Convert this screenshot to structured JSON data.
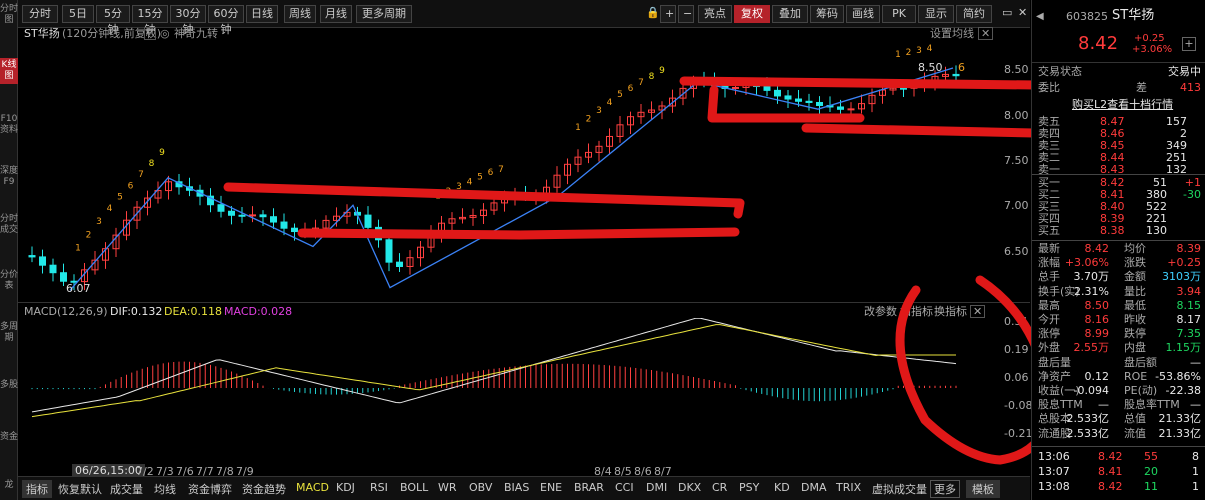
{
  "side_tabs": [
    "分时图",
    "K线图",
    "F10资料",
    "深度F9",
    "分时成交",
    "分价表",
    "多周期",
    "多股",
    "资金",
    "龙"
  ],
  "toolbar": {
    "left": [
      "分时",
      "5日",
      "5分钟",
      "15分钟",
      "30分钟",
      "60分钟",
      "日线",
      "周线",
      "月线",
      "更多周期"
    ],
    "right": [
      "亮点",
      "复权",
      "叠加",
      "筹码",
      "画线",
      "PK",
      "显示",
      "简约"
    ],
    "lock_icon": "lock-icon",
    "minus": "−",
    "plus": "+"
  },
  "chart_info": {
    "title": "ST华扬",
    "subtitle": "(120分钟线,前复权)",
    "help": "?",
    "extra": "神奇九转",
    "settings": "设置均线"
  },
  "price_axis": {
    "ticks": [
      "8.50",
      "8.00",
      "7.50",
      "7.00",
      "6.50"
    ]
  },
  "annotations": {
    "high_label": "8.50",
    "low_label": "6.07",
    "six": "6"
  },
  "nine_turn": [
    {
      "n": "1"
    },
    {
      "n": "2"
    },
    {
      "n": "3"
    },
    {
      "n": "4"
    },
    {
      "n": "5"
    },
    {
      "n": "6"
    },
    {
      "n": "7"
    },
    {
      "n": "8"
    },
    {
      "n": "9"
    }
  ],
  "macd": {
    "label": "MACD(12,26,9)",
    "dif": "DIF:0.132",
    "dea": "DEA:0.118",
    "macd": "MACD:0.028",
    "buttons": [
      "改参数",
      "加指标",
      "换指标"
    ],
    "ticks": [
      "0.31",
      "0.19",
      "0.06",
      "-0.08",
      "-0.21"
    ]
  },
  "dates": {
    "cursor": "06/26,15:00",
    "labels": [
      "7/2",
      "7/3",
      "7/6",
      "7/7",
      "7/8",
      "7/9",
      "8/4",
      "8/5",
      "8/6",
      "8/7"
    ]
  },
  "bottom_tabs": [
    "指标",
    "恢复默认",
    "成交量",
    "均线",
    "资金博弈",
    "资金趋势",
    "MACD",
    "KDJ",
    "RSI",
    "BOLL",
    "WR",
    "OBV",
    "BIAS",
    "ENE",
    "BRAR",
    "CCI",
    "DMI",
    "DKX",
    "CR",
    "PSY",
    "KD",
    "DMA",
    "TRIX",
    "虚拟成交量",
    "更多",
    "模板"
  ],
  "stock": {
    "code": "603825",
    "name": "ST华扬",
    "price": "8.42",
    "change": "+0.25",
    "pct": "+3.06%",
    "add_btn": "+"
  },
  "trade_status": {
    "label": "交易状态",
    "value": "交易中"
  },
  "ratio": {
    "label": "委比",
    "diff_label": "差",
    "diff": "413"
  },
  "l2_link": "购买L2查看十档行情",
  "asks": [
    {
      "l": "卖五",
      "p": "8.47",
      "v": "157"
    },
    {
      "l": "卖四",
      "p": "8.46",
      "v": "2"
    },
    {
      "l": "卖三",
      "p": "8.45",
      "v": "349"
    },
    {
      "l": "卖二",
      "p": "8.44",
      "v": "251"
    },
    {
      "l": "卖一",
      "p": "8.43",
      "v": "132"
    }
  ],
  "bids": [
    {
      "l": "买一",
      "p": "8.42",
      "v": "51",
      "c": "+1"
    },
    {
      "l": "买二",
      "p": "8.41",
      "v": "380",
      "c": "-30"
    },
    {
      "l": "买三",
      "p": "8.40",
      "v": "522",
      "c": ""
    },
    {
      "l": "买四",
      "p": "8.39",
      "v": "221",
      "c": ""
    },
    {
      "l": "买五",
      "p": "8.38",
      "v": "130",
      "c": ""
    }
  ],
  "stats": [
    {
      "a": "最新",
      "av": "8.42",
      "ac": "red",
      "b": "均价",
      "bv": "8.39",
      "bc": "red"
    },
    {
      "a": "涨幅",
      "av": "+3.06%",
      "ac": "red",
      "b": "涨跌",
      "bv": "+0.25",
      "bc": "red"
    },
    {
      "a": "总手",
      "av": "3.70万",
      "ac": "wht",
      "b": "金额",
      "bv": "3103万",
      "bc": "cyan"
    },
    {
      "a": "换手(实)",
      "av": "2.31%",
      "ac": "wht",
      "b": "量比",
      "bv": "3.94",
      "bc": "red"
    },
    {
      "a": "最高",
      "av": "8.50",
      "ac": "red",
      "b": "最低",
      "bv": "8.15",
      "bc": "grn"
    },
    {
      "a": "今开",
      "av": "8.16",
      "ac": "red",
      "b": "昨收",
      "bv": "8.17",
      "bc": "wht"
    },
    {
      "a": "涨停",
      "av": "8.99",
      "ac": "red",
      "b": "跌停",
      "bv": "7.35",
      "bc": "grn"
    },
    {
      "a": "外盘",
      "av": "2.55万",
      "ac": "red",
      "b": "内盘",
      "bv": "1.15万",
      "bc": "grn"
    },
    {
      "a": "盘后量",
      "av": "",
      "ac": "wht",
      "b": "盘后额",
      "bv": "—",
      "bc": "wht"
    },
    {
      "a": "净资产",
      "av": "0.12",
      "ac": "wht",
      "b": "ROE",
      "bv": "-53.86%",
      "bc": "wht"
    },
    {
      "a": "收益(一)",
      "av": "-0.094",
      "ac": "wht",
      "b": "PE(动)",
      "bv": "-22.38",
      "bc": "wht"
    },
    {
      "a": "股息TTM",
      "av": "—",
      "ac": "wht",
      "b": "股息率TTM",
      "bv": "—",
      "bc": "wht"
    },
    {
      "a": "总股本",
      "av": "2.533亿",
      "ac": "wht",
      "b": "总值",
      "bv": "21.33亿",
      "bc": "wht"
    },
    {
      "a": "流通股",
      "av": "2.533亿",
      "ac": "wht",
      "b": "流值",
      "bv": "21.33亿",
      "bc": "wht"
    }
  ],
  "ticks_list": [
    {
      "t": "13:06",
      "p": "8.42",
      "v": "55",
      "n": "8"
    },
    {
      "t": "13:07",
      "p": "8.41",
      "v": "20",
      "n": "1"
    },
    {
      "t": "13:08",
      "p": "8.42",
      "v": "11",
      "n": "1"
    }
  ]
}
